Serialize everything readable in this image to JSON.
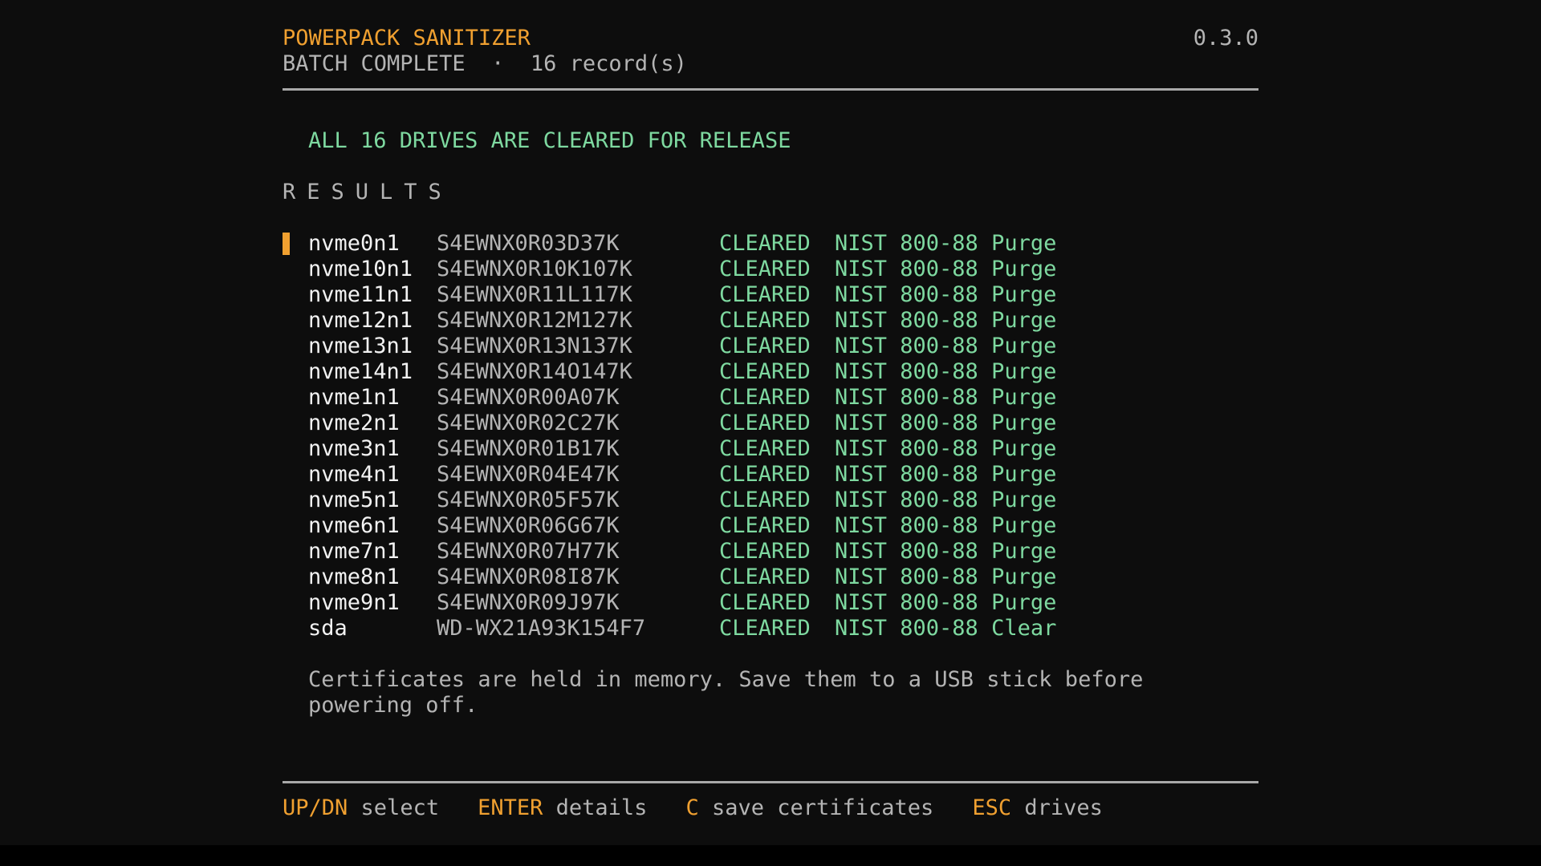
{
  "header": {
    "title": "POWERPACK SANITIZER",
    "status": "BATCH COMPLETE",
    "separator": "·",
    "record_count": "16 record(s)",
    "version": "0.3.0"
  },
  "banner": "ALL 16 DRIVES ARE CLEARED FOR RELEASE",
  "results_heading": "RESULTS",
  "selected_index": 0,
  "results": [
    {
      "device": "nvme0n1",
      "serial": "S4EWNX0R03D37K",
      "status": "CLEARED",
      "method": "NIST 800-88 Purge"
    },
    {
      "device": "nvme10n1",
      "serial": "S4EWNX0R10K107K",
      "status": "CLEARED",
      "method": "NIST 800-88 Purge"
    },
    {
      "device": "nvme11n1",
      "serial": "S4EWNX0R11L117K",
      "status": "CLEARED",
      "method": "NIST 800-88 Purge"
    },
    {
      "device": "nvme12n1",
      "serial": "S4EWNX0R12M127K",
      "status": "CLEARED",
      "method": "NIST 800-88 Purge"
    },
    {
      "device": "nvme13n1",
      "serial": "S4EWNX0R13N137K",
      "status": "CLEARED",
      "method": "NIST 800-88 Purge"
    },
    {
      "device": "nvme14n1",
      "serial": "S4EWNX0R14O147K",
      "status": "CLEARED",
      "method": "NIST 800-88 Purge"
    },
    {
      "device": "nvme1n1",
      "serial": "S4EWNX0R00A07K",
      "status": "CLEARED",
      "method": "NIST 800-88 Purge"
    },
    {
      "device": "nvme2n1",
      "serial": "S4EWNX0R02C27K",
      "status": "CLEARED",
      "method": "NIST 800-88 Purge"
    },
    {
      "device": "nvme3n1",
      "serial": "S4EWNX0R01B17K",
      "status": "CLEARED",
      "method": "NIST 800-88 Purge"
    },
    {
      "device": "nvme4n1",
      "serial": "S4EWNX0R04E47K",
      "status": "CLEARED",
      "method": "NIST 800-88 Purge"
    },
    {
      "device": "nvme5n1",
      "serial": "S4EWNX0R05F57K",
      "status": "CLEARED",
      "method": "NIST 800-88 Purge"
    },
    {
      "device": "nvme6n1",
      "serial": "S4EWNX0R06G67K",
      "status": "CLEARED",
      "method": "NIST 800-88 Purge"
    },
    {
      "device": "nvme7n1",
      "serial": "S4EWNX0R07H77K",
      "status": "CLEARED",
      "method": "NIST 800-88 Purge"
    },
    {
      "device": "nvme8n1",
      "serial": "S4EWNX0R08I87K",
      "status": "CLEARED",
      "method": "NIST 800-88 Purge"
    },
    {
      "device": "nvme9n1",
      "serial": "S4EWNX0R09J97K",
      "status": "CLEARED",
      "method": "NIST 800-88 Purge"
    },
    {
      "device": "sda",
      "serial": "WD-WX21A93K154F7",
      "status": "CLEARED",
      "method": "NIST 800-88 Clear"
    }
  ],
  "note": "Certificates are held in memory. Save them to a USB stick before powering off.",
  "footer": {
    "keys": [
      {
        "key": "UP/DN",
        "action": "select"
      },
      {
        "key": "ENTER",
        "action": "details"
      },
      {
        "key": "C",
        "action": "save certificates"
      },
      {
        "key": "ESC",
        "action": "drives"
      }
    ]
  },
  "colors": {
    "accent": "#f0a030",
    "success": "#7ed9a0",
    "text": "#c8c8c8",
    "background": "#0d0d0d"
  }
}
